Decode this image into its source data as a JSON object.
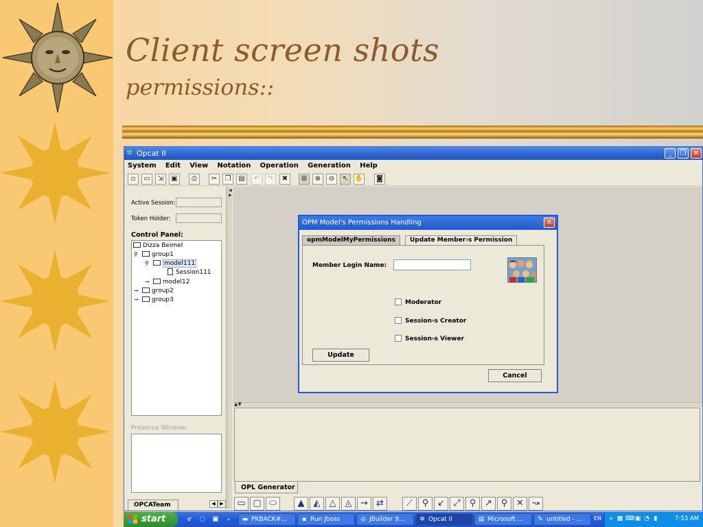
{
  "slide": {
    "title": "Client screen shots",
    "subtitle": "permissions::"
  },
  "window": {
    "title": "Opcat II",
    "controls": {
      "minimize": "_",
      "restore": "❐",
      "close": "✕"
    }
  },
  "menu": [
    "System",
    "Edit",
    "View",
    "Notation",
    "Operation",
    "Generation",
    "Help"
  ],
  "toolbar_icons": [
    "new-file-icon",
    "open-folder-icon",
    "export-icon",
    "save-icon",
    "print-icon",
    "cut-icon",
    "copy-icon",
    "paste-icon",
    "undo-icon",
    "redo-icon",
    "delete-icon",
    "fit-icon",
    "zoom-in-icon",
    "zoom-out-icon",
    "pointer-icon",
    "hand-icon",
    "camera-icon"
  ],
  "left_panel": {
    "active_session_label": "Active Session:",
    "active_session_value": "",
    "token_holder_label": "Token Holder:",
    "token_holder_value": "",
    "control_panel_label": "Control Panel:",
    "tree": [
      {
        "label": "Dizza Beimel",
        "depth": 0,
        "kind": "folder"
      },
      {
        "label": "group1",
        "depth": 1,
        "kind": "folder",
        "toggle": "open"
      },
      {
        "label": "model111",
        "depth": 2,
        "kind": "folder",
        "toggle": "open",
        "selected": true
      },
      {
        "label": "Session111",
        "depth": 3,
        "kind": "doc"
      },
      {
        "label": "model12",
        "depth": 2,
        "kind": "folder",
        "toggle": "closed"
      },
      {
        "label": "group2",
        "depth": 1,
        "kind": "folder",
        "toggle": "closed"
      },
      {
        "label": "group3",
        "depth": 1,
        "kind": "folder",
        "toggle": "closed"
      }
    ],
    "presence_window_label": "Presence Window:",
    "tab_label": "OPCATeam"
  },
  "dialog": {
    "title": "OPM Model's Permissions Handling",
    "tabs": [
      "opmModelMyPermissions",
      "Update Member›s Permission"
    ],
    "active_tab": 0,
    "login_label": "Member Login Name:",
    "login_value": "",
    "checkboxes": [
      {
        "label": "Moderator",
        "checked": false
      },
      {
        "label": "Session›s Creator",
        "checked": false
      },
      {
        "label": "Session›s Viewer",
        "checked": false
      }
    ],
    "update_button": "Update",
    "cancel_button": "Cancel"
  },
  "opl_tab_label": "OPL Generator",
  "palette_icons": [
    "rectangle-icon",
    "rounded-rect-icon",
    "ellipse-icon",
    "filled-triangle-icon",
    "triangle-in-triangle-icon",
    "outline-triangle-icon",
    "dotted-triangle-icon",
    "arrow-right-icon",
    "double-arrow-icon",
    "link-icon",
    "agent-link-icon",
    "instrument-link-icon",
    "effect-link-icon",
    "consumption-link-icon",
    "result-link-icon",
    "event-link-icon",
    "exception-link-icon",
    "invocation-link-icon"
  ],
  "taskbar": {
    "start_label": "start",
    "tasks": [
      {
        "label": "PKBACK#...",
        "icon": "drive-icon"
      },
      {
        "label": "Run Jboss",
        "icon": "console-icon"
      },
      {
        "label": "JBuilder 9...",
        "icon": "jbuilder-icon"
      },
      {
        "label": "Opcat II",
        "icon": "opcat-icon",
        "active": true
      },
      {
        "label": "Microsoft ...",
        "icon": "powerpoint-icon"
      },
      {
        "label": "untitled - ...",
        "icon": "paint-icon"
      }
    ],
    "language": "EN",
    "clock": "7:53 AM"
  },
  "colors": {
    "title_brown": "#8c5a2b",
    "xp_blue": "#2b63cf",
    "start_green": "#3a9c36",
    "sun_gold": "#e8b030"
  }
}
